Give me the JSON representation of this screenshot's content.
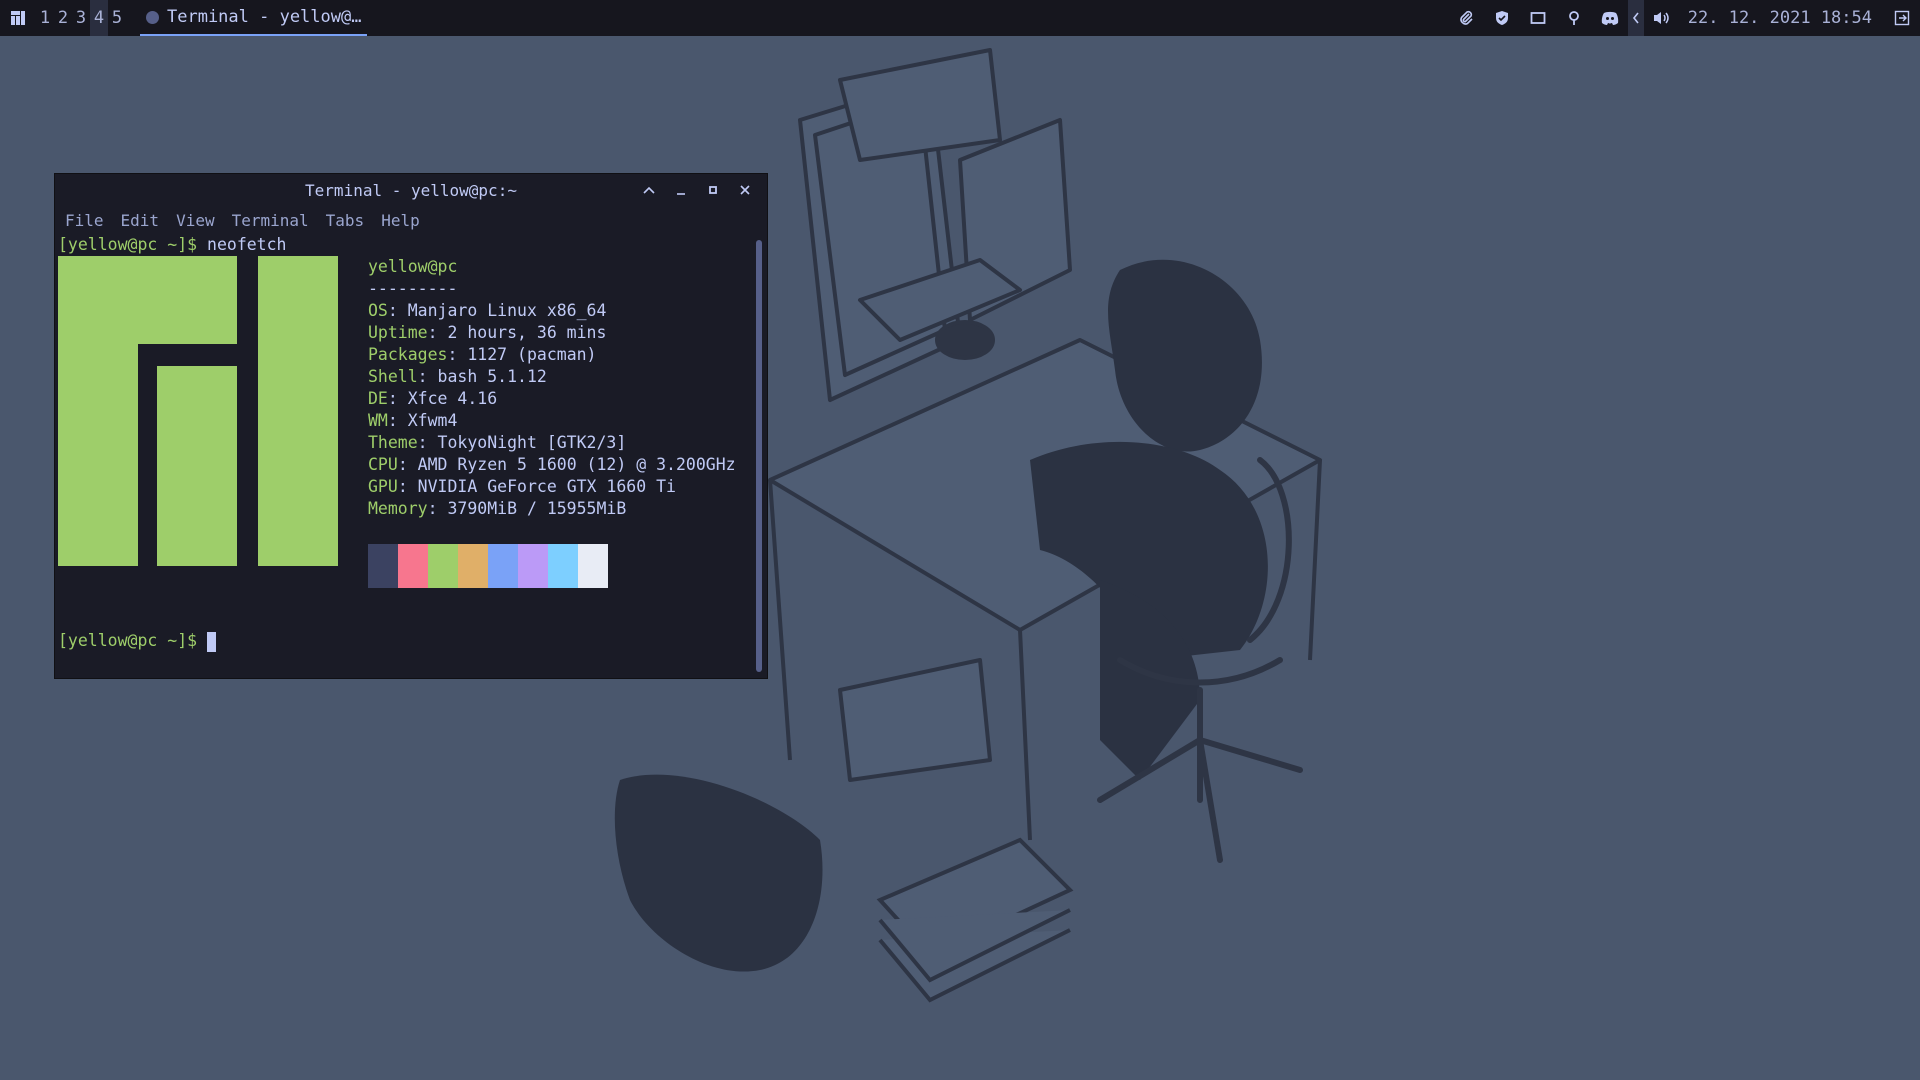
{
  "panel": {
    "workspaces": [
      "1",
      "2",
      "3",
      "4",
      "5"
    ],
    "active_workspace": "4",
    "task_title": "Terminal - yellow@…",
    "tray_icons": [
      "paperclip-icon",
      "shield-icon",
      "monitor-icon",
      "location-pin-icon",
      "discord-icon",
      "collapse-arrow-icon",
      "volume-icon"
    ],
    "clock": "22. 12. 2021 18:54",
    "logout_icon": "logout-icon"
  },
  "terminal": {
    "title": "Terminal - yellow@pc:~",
    "menu": [
      "File",
      "Edit",
      "View",
      "Terminal",
      "Tabs",
      "Help"
    ],
    "prompt": "[yellow@pc ~]$",
    "command": " neofetch",
    "neofetch": {
      "header": "yellow@pc",
      "separator": "---------",
      "items": [
        {
          "key": "OS",
          "value": ": Manjaro Linux x86_64"
        },
        {
          "key": "Uptime",
          "value": ": 2 hours, 36 mins"
        },
        {
          "key": "Packages",
          "value": ": 1127 (pacman)"
        },
        {
          "key": "Shell",
          "value": ": bash 5.1.12"
        },
        {
          "key": "DE",
          "value": ": Xfce 4.16"
        },
        {
          "key": "WM",
          "value": ": Xfwm4"
        },
        {
          "key": "Theme",
          "value": ": TokyoNight [GTK2/3]"
        },
        {
          "key": "CPU",
          "value": ": AMD Ryzen 5 1600 (12) @ 3.200GHz"
        },
        {
          "key": "GPU",
          "value": ": NVIDIA GeForce GTX 1660 Ti"
        },
        {
          "key": "Memory",
          "value": ": 3790MiB / 15955MiB"
        }
      ],
      "palette": [
        "#3b4261",
        "#f7768e",
        "#9ece6a",
        "#e0af68",
        "#7aa2f7",
        "#bb9af7",
        "#7dcfff",
        "#e8ecf5"
      ]
    }
  },
  "colors": {
    "desktop": "#4a576d",
    "panel": "#16161e",
    "terminal_bg": "#1a1b26",
    "accent_green": "#9ece6a",
    "text": "#c0caf5"
  }
}
